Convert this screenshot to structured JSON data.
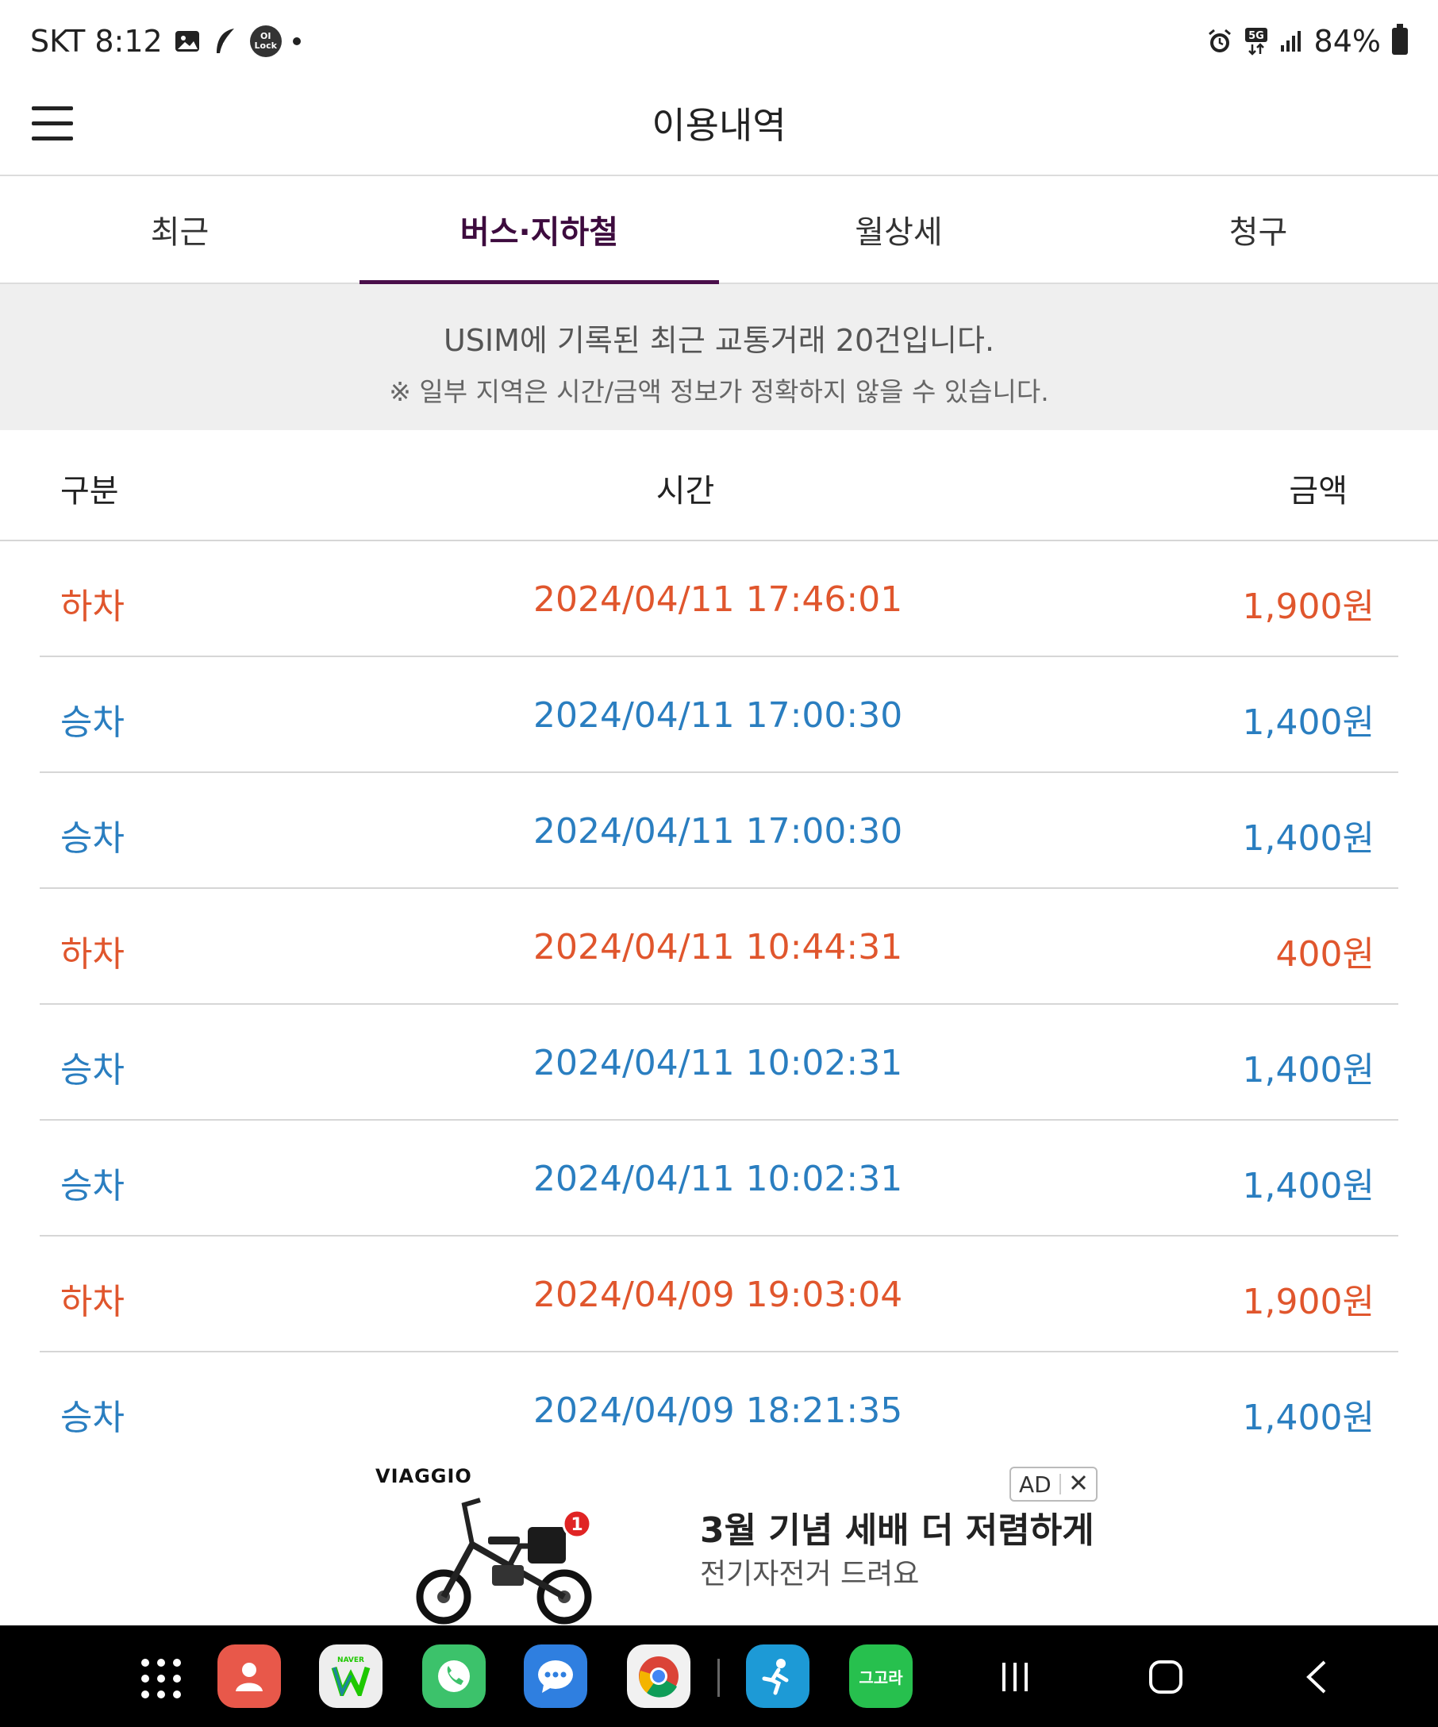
{
  "status_bar": {
    "carrier_time": "SKT 8:12",
    "left_icons": [
      "gallery-icon",
      "feather-icon",
      "lock-badge-icon",
      "notification-dot"
    ],
    "lock_badge_text": "OI\nLock",
    "network": "5G",
    "battery": "84%"
  },
  "app_bar": {
    "title": "이용내역",
    "menu_icon": "hamburger-menu-icon"
  },
  "tabs": [
    {
      "label": "최근",
      "active": false
    },
    {
      "label": "버스·지하철",
      "active": true
    },
    {
      "label": "월상세",
      "active": false
    },
    {
      "label": "청구",
      "active": false
    }
  ],
  "notice": {
    "line1": "USIM에 기록된 최근 교통거래 20건입니다.",
    "line2": "※ 일부 지역은 시간/금액 정보가 정확하지 않을 수 있습니다."
  },
  "table": {
    "headers": {
      "type": "구분",
      "time": "시간",
      "amount": "금액"
    },
    "rows": [
      {
        "type": "하차",
        "time": "2024/04/11 17:46:01",
        "amount": "1,900원",
        "kind": "off"
      },
      {
        "type": "승차",
        "time": "2024/04/11 17:00:30",
        "amount": "1,400원",
        "kind": "on"
      },
      {
        "type": "승차",
        "time": "2024/04/11 17:00:30",
        "amount": "1,400원",
        "kind": "on"
      },
      {
        "type": "하차",
        "time": "2024/04/11 10:44:31",
        "amount": "400원",
        "kind": "off"
      },
      {
        "type": "승차",
        "time": "2024/04/11 10:02:31",
        "amount": "1,400원",
        "kind": "on"
      },
      {
        "type": "승차",
        "time": "2024/04/11 10:02:31",
        "amount": "1,400원",
        "kind": "on"
      },
      {
        "type": "하차",
        "time": "2024/04/09 19:03:04",
        "amount": "1,900원",
        "kind": "off"
      },
      {
        "type": "승차",
        "time": "2024/04/09 18:21:35",
        "amount": "1,400원",
        "kind": "on"
      }
    ]
  },
  "ad": {
    "brand": "VIAGGIO",
    "badge_count": "1",
    "headline": "3월 기념 세배 더 저렴하게",
    "subtext": "전기자전거 드려요",
    "ad_label": "AD",
    "close_icon": "close-icon"
  },
  "nav_bar": {
    "apps": [
      {
        "name": "contacts-app",
        "bg": "#e8584a"
      },
      {
        "name": "naver-whale-app",
        "bg": "#eeeeee"
      },
      {
        "name": "phone-app",
        "bg": "#3cc26b"
      },
      {
        "name": "messages-app",
        "bg": "#2f7fe0"
      },
      {
        "name": "chrome-app",
        "bg": "#f1f1f1"
      },
      {
        "name": "fitness-app",
        "bg": "#1d9ad6"
      },
      {
        "name": "gogora-app",
        "bg": "#27c04e"
      }
    ],
    "naver_label": "NAVER",
    "gogora_label": "그고라"
  },
  "colors": {
    "tab_active": "#4a0f4b",
    "off_text": "#e0562d",
    "on_text": "#2a7ec0",
    "notice_bg": "#efefef"
  }
}
